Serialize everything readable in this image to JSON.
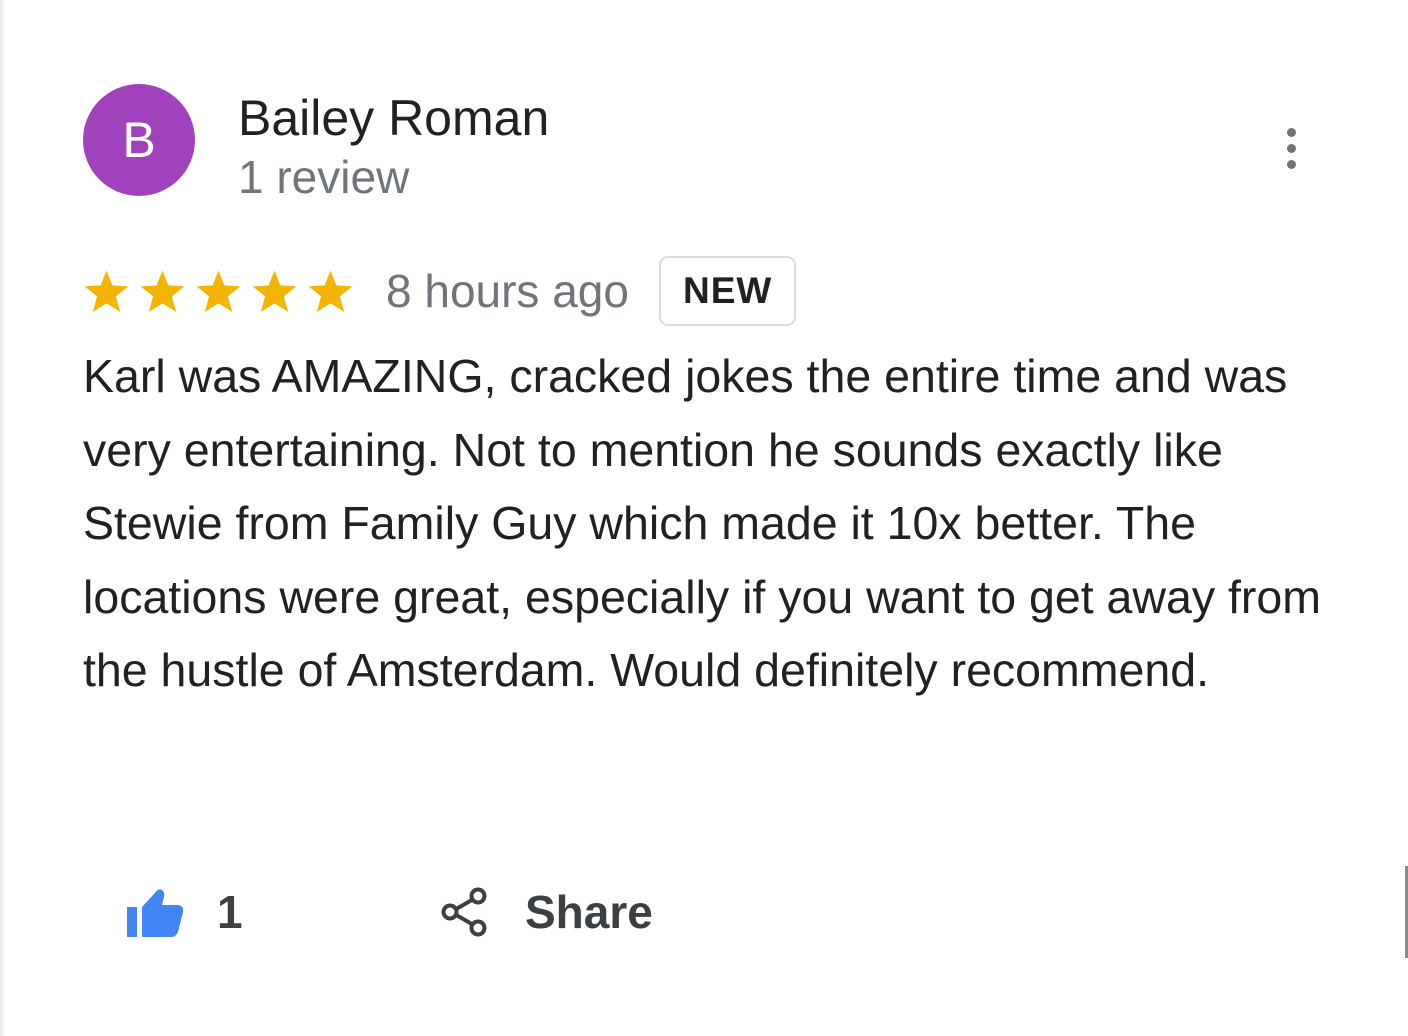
{
  "reviewer": {
    "initial": "B",
    "name": "Bailey Roman",
    "review_count": "1 review",
    "avatar_color": "#a142bd"
  },
  "menu": {
    "icon": "more-vert-icon"
  },
  "review": {
    "rating": 5,
    "max_rating": 5,
    "star_color": "#f4b400",
    "timestamp": "8 hours ago",
    "badge": "NEW",
    "text": "Karl was AMAZING, cracked jokes the entire time and was very entertaining. Not to mention he sounds exactly like Stewie from Family Guy which made it 10x better. The locations were great, especially if you want to get away from the hustle of Amsterdam. Would definitely recommend."
  },
  "actions": {
    "like": {
      "icon": "thumbs-up-icon",
      "count": "1",
      "color": "#4285f4"
    },
    "share": {
      "icon": "share-icon",
      "label": "Share"
    }
  }
}
